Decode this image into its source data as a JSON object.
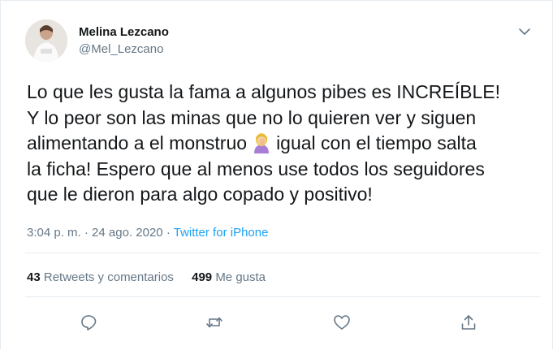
{
  "tweet": {
    "author_name": "Melina Lezcano",
    "author_handle": "@Mel_Lezcano",
    "text_lines": [
      "Lo que les gusta la fama a algunos pibes es INCREÍBLE!",
      "Y lo peor son las minas que no lo quieren ver y siguen",
      "alimentando a el monstruo",
      "igual con el tiempo salta",
      "la ficha! Espero que al menos use todos los seguidores",
      "que le dieron para algo copado y positivo!"
    ],
    "emoji": "woman-facepalming-icon",
    "time": "3:04 p. m.",
    "date": "24 ago. 2020",
    "separator": "·",
    "source": "Twitter for iPhone"
  },
  "stats": {
    "retweets_count": "43",
    "retweets_label": "Retweets y comentarios",
    "likes_count": "499",
    "likes_label": "Me gusta"
  },
  "colors": {
    "accent": "#1da1f2",
    "secondary_text": "#657786",
    "border": "#e6ecf0"
  }
}
